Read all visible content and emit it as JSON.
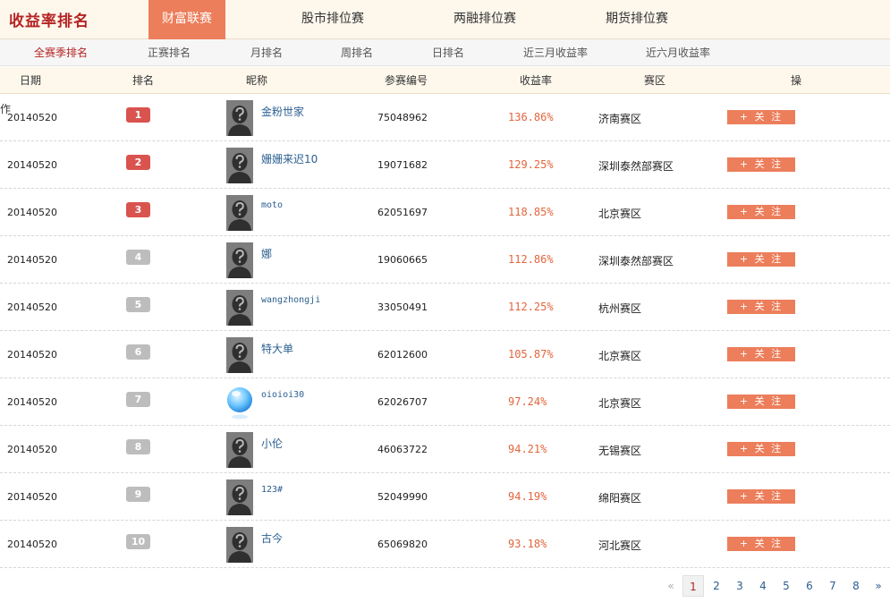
{
  "brand": "收益率排名",
  "tabs": [
    "财富联赛",
    "股市排位赛",
    "两融排位赛",
    "期货排位赛"
  ],
  "subnav": [
    "全赛季排名",
    "正赛排名",
    "月排名",
    "周排名",
    "日排名",
    "近三月收益率",
    "近六月收益率"
  ],
  "columns": [
    "日期",
    "排名",
    "昵称",
    "参赛编号",
    "收益率",
    "赛区",
    "操"
  ],
  "stray_text": "作",
  "follow_label": "+ 关 注",
  "rows": [
    {
      "date": "20140520",
      "rank": "1",
      "nick": "金粉世家",
      "code": "75048962",
      "ret": "136.86%",
      "region": "济南赛区"
    },
    {
      "date": "20140520",
      "rank": "2",
      "nick": "姗姗来迟10",
      "code": "19071682",
      "ret": "129.25%",
      "region": "深圳泰然部赛区"
    },
    {
      "date": "20140520",
      "rank": "3",
      "nick": "moto",
      "code": "62051697",
      "ret": "118.85%",
      "region": "北京赛区"
    },
    {
      "date": "20140520",
      "rank": "4",
      "nick": "娜",
      "code": "19060665",
      "ret": "112.86%",
      "region": "深圳泰然部赛区"
    },
    {
      "date": "20140520",
      "rank": "5",
      "nick": "wangzhongji",
      "code": "33050491",
      "ret": "112.25%",
      "region": "杭州赛区"
    },
    {
      "date": "20140520",
      "rank": "6",
      "nick": "特大单",
      "code": "62012600",
      "ret": "105.87%",
      "region": "北京赛区"
    },
    {
      "date": "20140520",
      "rank": "7",
      "nick": "oioioi30",
      "code": "62026707",
      "ret": "97.24%",
      "region": "北京赛区"
    },
    {
      "date": "20140520",
      "rank": "8",
      "nick": "小伦",
      "code": "46063722",
      "ret": "94.21%",
      "region": "无锡赛区"
    },
    {
      "date": "20140520",
      "rank": "9",
      "nick": "123#",
      "code": "52049990",
      "ret": "94.19%",
      "region": "绵阳赛区"
    },
    {
      "date": "20140520",
      "rank": "10",
      "nick": "古今",
      "code": "65069820",
      "ret": "93.18%",
      "region": "河北赛区"
    }
  ],
  "pagination": {
    "prev": "«",
    "pages": [
      "1",
      "2",
      "3",
      "4",
      "5",
      "6",
      "7",
      "8"
    ],
    "next": "»",
    "current": "1"
  },
  "colors": {
    "accent": "#ec7e5b",
    "brand": "#b52424",
    "rank_top": "#d9534f",
    "rank_rest": "#bdbdbd",
    "return": "#e2663d",
    "link": "#2b5f90"
  },
  "icons": {
    "default_avatar": "default-avatar-icon",
    "bubble_avatar": "blue-bubble-avatar-icon"
  }
}
